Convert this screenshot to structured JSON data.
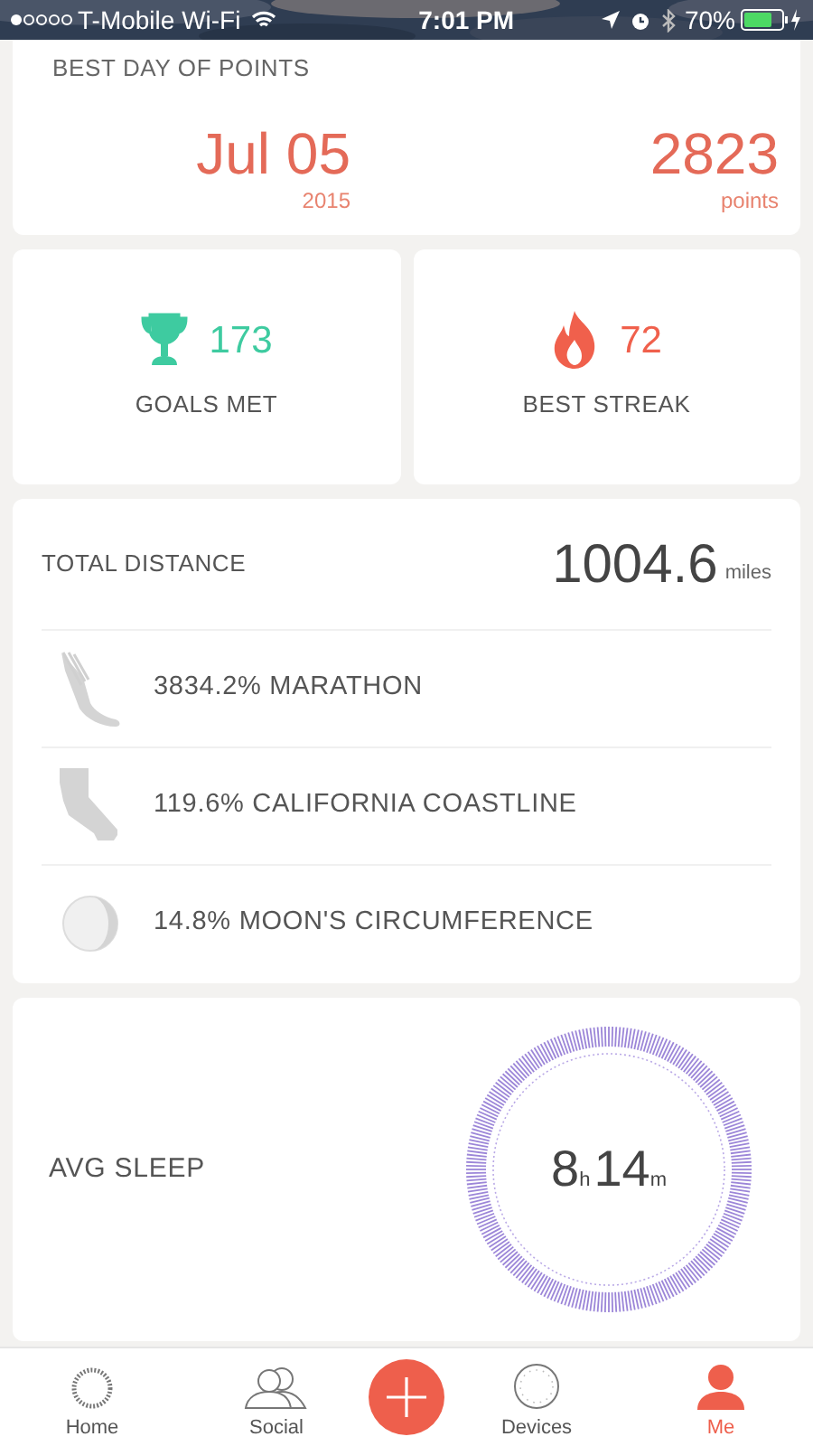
{
  "status_bar": {
    "carrier": "T-Mobile Wi-Fi",
    "time": "7:01 PM",
    "battery": "70%"
  },
  "best_day": {
    "title": "BEST DAY OF POINTS",
    "date": "Jul 05",
    "year": "2015",
    "points": "2823",
    "points_unit": "points"
  },
  "stats": [
    {
      "kind": "trophy",
      "value": "173",
      "label": "GOALS MET",
      "color": "#3ecba0"
    },
    {
      "kind": "flame",
      "value": "72",
      "label": "BEST STREAK",
      "color": "#f0604c"
    }
  ],
  "distance": {
    "title": "TOTAL DISTANCE",
    "value": "1004.6",
    "unit": "miles",
    "items": [
      {
        "kind": "shoe",
        "text": "3834.2% MARATHON"
      },
      {
        "kind": "california",
        "text": "119.6% CALIFORNIA COASTLINE"
      },
      {
        "kind": "moon",
        "text": "14.8% MOON'S CIRCUMFERENCE"
      }
    ]
  },
  "sleep": {
    "title": "AVG SLEEP",
    "hours": "8",
    "hours_unit": "h",
    "minutes": "14",
    "minutes_unit": "m"
  },
  "tab_bar": [
    {
      "kind": "home",
      "label": "Home",
      "selected": false
    },
    {
      "kind": "social",
      "label": "Social",
      "selected": false
    },
    {
      "kind": "add"
    },
    {
      "kind": "devices",
      "label": "Devices",
      "selected": false
    },
    {
      "kind": "me",
      "label": "Me",
      "selected": true
    }
  ]
}
